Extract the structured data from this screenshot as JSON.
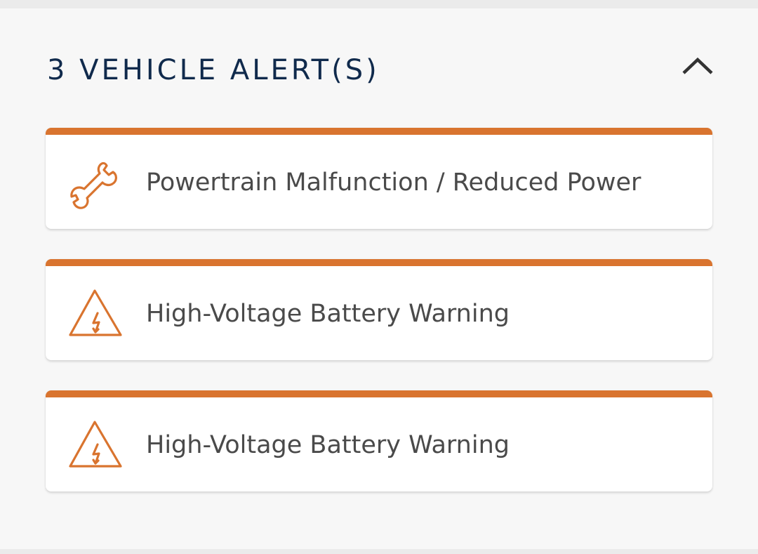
{
  "alerts_panel": {
    "title": "3 VEHICLE ALERT(S)",
    "toggle_icon": "chevron-up-icon",
    "accent_color": "#d9742f",
    "title_color": "#102a4c",
    "alerts": [
      {
        "label": "Powertrain Malfunction / Reduced Power",
        "icon": "wrench-icon"
      },
      {
        "label": "High-Voltage Battery Warning",
        "icon": "high-voltage-warning-icon"
      },
      {
        "label": "High-Voltage Battery Warning",
        "icon": "high-voltage-warning-icon"
      }
    ]
  }
}
